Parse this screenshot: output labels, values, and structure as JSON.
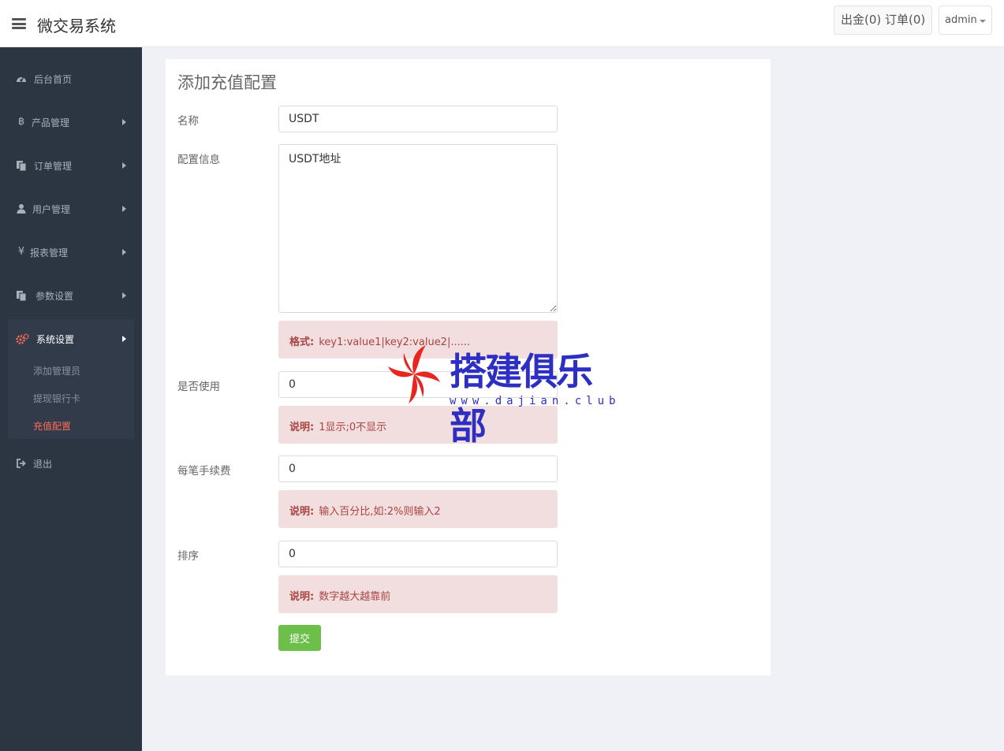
{
  "header": {
    "app_title": "微交易系统",
    "stats_label": "出金(0) 订单(0)",
    "user_label": "admin"
  },
  "sidebar": {
    "items": [
      {
        "label": "后台首页",
        "icon": "dashboard-icon"
      },
      {
        "label": "产品管理",
        "icon": "bitcoin-icon"
      },
      {
        "label": "订单管理",
        "icon": "copy-icon"
      },
      {
        "label": "用户管理",
        "icon": "user-icon"
      },
      {
        "label": "报表管理",
        "icon": "yen-icon"
      },
      {
        "label": "参数设置",
        "icon": "copy-icon"
      },
      {
        "label": "系统设置",
        "icon": "gears-icon"
      },
      {
        "label": "退出",
        "icon": "sign-out-icon"
      }
    ],
    "subitems": [
      {
        "label": "添加管理员"
      },
      {
        "label": "提现银行卡"
      },
      {
        "label": "充值配置",
        "active": true
      }
    ]
  },
  "form": {
    "title": "添加充值配置",
    "name_label": "名称",
    "name_value": "USDT",
    "config_label": "配置信息",
    "config_value": "USDT地址",
    "format_note_head": "格式:",
    "format_note_text": "key1:value1|key2:value2|......",
    "enabled_label": "是否使用",
    "enabled_value": "0",
    "enabled_note_head": "说明:",
    "enabled_note_text": "1显示;0不显示",
    "fee_label": "每笔手续费",
    "fee_value": "0",
    "fee_note_head": "说明:",
    "fee_note_text": "输入百分比,如:2%则输入2",
    "sort_label": "排序",
    "sort_value": "0",
    "sort_note_head": "说明:",
    "sort_note_text": "数字越大越靠前",
    "submit_label": "提交"
  },
  "watermark": {
    "text": "搭建俱乐部",
    "url": "www.dajian.club"
  },
  "colors": {
    "sidebar_bg": "#2c3542",
    "active_accent": "#ff6b5b",
    "submit_green": "#6cc04a",
    "note_bg": "#f2dede",
    "note_text": "#a94442",
    "watermark_blue": "#2d2fc2",
    "watermark_red": "#e8251f"
  }
}
